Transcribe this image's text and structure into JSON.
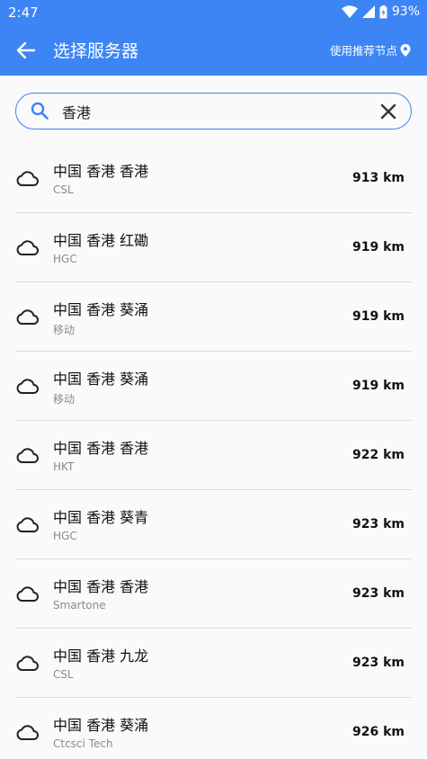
{
  "status_bar": {
    "time": "2:47",
    "battery": "93%"
  },
  "app_bar": {
    "title": "选择服务器",
    "recommend_label": "使用推荐节点"
  },
  "search": {
    "value": "香港"
  },
  "servers": [
    {
      "name": "中国 香港 香港",
      "isp": "CSL",
      "distance": "913 km"
    },
    {
      "name": "中国 香港 红磡",
      "isp": "HGC",
      "distance": "919 km"
    },
    {
      "name": "中国 香港 葵涌",
      "isp": "移动",
      "distance": "919 km"
    },
    {
      "name": "中国 香港 葵涌",
      "isp": "移动",
      "distance": "919 km"
    },
    {
      "name": "中国 香港 香港",
      "isp": "HKT",
      "distance": "922 km"
    },
    {
      "name": "中国 香港 葵青",
      "isp": "HGC",
      "distance": "923 km"
    },
    {
      "name": "中国 香港 香港",
      "isp": "Smartone",
      "distance": "923 km"
    },
    {
      "name": "中国 香港 九龙",
      "isp": "CSL",
      "distance": "923 km"
    },
    {
      "name": "中国 香港 葵涌",
      "isp": "Ctcsci Tech",
      "distance": "926 km"
    }
  ]
}
